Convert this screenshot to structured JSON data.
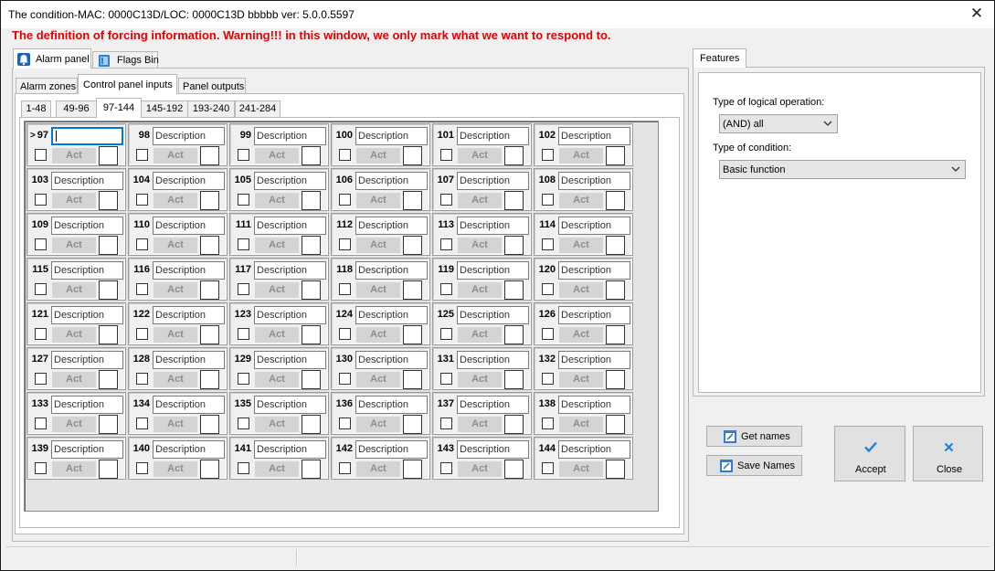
{
  "window": {
    "title": "The condition-MAC: 0000C13D/LOC: 0000C13D bbbbb ver: 5.0.0.5597",
    "close_glyph": "✕"
  },
  "warning_text": "The definition of forcing information. Warning!!! in this window, we only mark what we want to respond to.",
  "top_tabs": [
    {
      "label": "Alarm panel",
      "icon": "alarm-panel-icon",
      "active": true
    },
    {
      "label": "Flags Bin",
      "icon": "flags-bin-icon",
      "active": false
    }
  ],
  "sub_tabs": [
    {
      "label": "Alarm zones",
      "active": false
    },
    {
      "label": "Control panel inputs",
      "active": true
    },
    {
      "label": "Panel outputs",
      "active": false
    }
  ],
  "bank_tabs": [
    {
      "label": "1-48",
      "active": false
    },
    {
      "label": "49-96",
      "active": false
    },
    {
      "label": "97-144",
      "active": true
    },
    {
      "label": "145-192",
      "active": false
    },
    {
      "label": "193-240",
      "active": false
    },
    {
      "label": "241-284",
      "active": false
    }
  ],
  "inputs": {
    "first": 97,
    "count": 48,
    "columns": 6,
    "selected_marker": ">",
    "description_placeholder": "Description",
    "act_label": "Act"
  },
  "features": {
    "tab_label": "Features",
    "logical_op_label": "Type of logical operation:",
    "logical_op_value": "(AND) all",
    "condition_label": "Type of condition:",
    "condition_value": "Basic function"
  },
  "buttons": {
    "get_names": "Get names",
    "save_names": "Save Names",
    "accept": "Accept",
    "close": "Close"
  },
  "colors": {
    "warning": "#e30000",
    "accept_check": "#1e7fd6",
    "close_x": "#1e7fd6"
  }
}
